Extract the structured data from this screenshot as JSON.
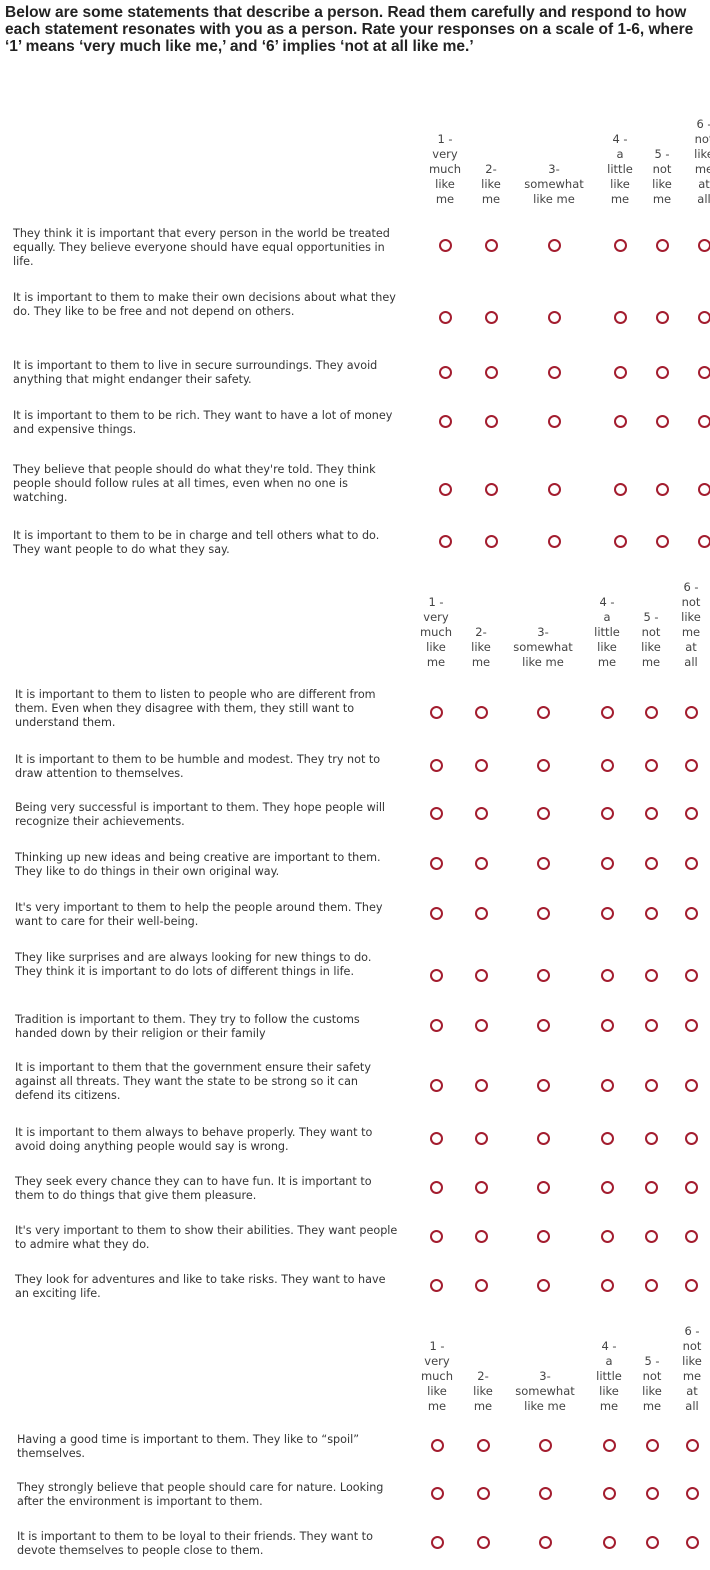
{
  "instructions": "Below are some statements that describe a person. Read them carefully and respond to how each statement resonates with you as a person. Rate your responses on a scale of 1-6, where ‘1’ means ‘very much like me,’ and ‘6’ implies ‘not at all like me.’",
  "scale": {
    "columns": [
      {
        "lines": [
          "1 -",
          "very",
          "much",
          "like",
          "me"
        ]
      },
      {
        "lines": [
          "2-",
          "like",
          "me"
        ]
      },
      {
        "lines": [
          "3-",
          "somewhat",
          "like me"
        ]
      },
      {
        "lines": [
          "4 -",
          "a",
          "little",
          "like",
          "me"
        ]
      },
      {
        "lines": [
          "5 -",
          "not",
          "like",
          "me"
        ]
      },
      {
        "lines": [
          "6 -",
          "not",
          "like",
          "me",
          "at",
          "all"
        ]
      }
    ]
  },
  "sections": [
    {
      "statements": [
        "They think it is important that every person in the world be treated equally. They believe everyone should have equal opportunities in life.",
        "It is important to them to make their own decisions about what they do. They like to be free and not depend on others.",
        "It is important to them to live in secure surroundings. They avoid anything that might endanger their safety.",
        "It is important to them to be rich. They want to have a lot of money and expensive things.",
        "They believe that people should do what they're told. They think people should follow rules at all times, even when no one is watching.",
        "It is important to them to be in charge and tell others what to do. They want people to do what they say."
      ]
    },
    {
      "statements": [
        "It is important to them to listen to people who are different from them. Even when they disagree with them, they still want to understand them.",
        "It is important to them to be humble and modest. They try not to draw attention to themselves.",
        "Being very successful is important to them. They hope people will recognize their achievements.",
        "Thinking up new ideas and being creative are important to them. They like to do things in their own original way.",
        "It's very important to them to help the people around them. They want to care for their well-being.",
        "They like surprises and are always looking for new things to do. They think it is important to do lots of different things in life.",
        "Tradition is important to them. They try to follow the customs handed down by their religion or their family",
        "It is important to them that the government ensure their safety against all threats. They want the state to be strong so it can defend its citizens.",
        "It is important to them always to behave properly. They want to avoid doing anything people would say is wrong.",
        "They seek every chance they can to have fun. It is important to them to do things that give them pleasure.",
        "It's very important to them to show their abilities. They want people to admire what they do.",
        "They look for adventures and like to take risks. They want to have an exciting life."
      ]
    },
    {
      "statements": [
        "Having a good time is important to them. They like to “spoil” themselves.",
        "They strongly believe that people should care for nature. Looking after the environment is important to them.",
        "It is important to them to be loyal to their friends. They want to devote themselves to people close to them."
      ]
    }
  ],
  "colors": {
    "radio_border": "#a31d2f",
    "text": "#333333"
  }
}
